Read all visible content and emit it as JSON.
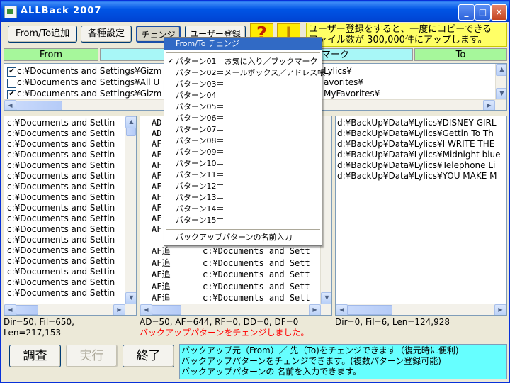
{
  "window": {
    "title": "ALLBack 2007",
    "minimize_glyph": "_",
    "maximize_glyph": "□",
    "close_glyph": "×"
  },
  "toolbar": {
    "fromto_add": "From/To追加",
    "settings": "各種設定",
    "change": "チェンジ",
    "user_register": "ユーザー登録",
    "help_glyph": "?",
    "register_glyph": "I"
  },
  "banner": {
    "line1": "ユーザー登録をすると、一度にコピーできる",
    "line2": "ファイル数が 300,000件にアップします。"
  },
  "headers": {
    "from": "From",
    "middle": "マーク",
    "to": "To"
  },
  "from_to_list": [
    {
      "checked": true,
      "from": "c:¥Documents and Settings¥Gizm",
      "to": "Lylics¥"
    },
    {
      "checked": false,
      "from": "c:¥Documents and Settings¥All U",
      "to": "avorites¥"
    },
    {
      "checked": true,
      "from": "c:¥Documents and Settings¥Gizm",
      "to": "MyFavorites¥"
    }
  ],
  "left_panel": {
    "lines": [
      "c:¥Documents and Settin",
      "c:¥Documents and Settin",
      "c:¥Documents and Settin",
      "c:¥Documents and Settin",
      "c:¥Documents and Settin",
      "c:¥Documents and Settin",
      "c:¥Documents and Settin",
      "c:¥Documents and Settin",
      "c:¥Documents and Settin",
      "c:¥Documents and Settin",
      "c:¥Documents and Settin",
      "c:¥Documents and Settin",
      "c:¥Documents and Settin",
      "c:¥Documents and Settin",
      "c:¥Documents and Settin",
      "c:¥Documents and Settin",
      "c:¥Documents and Settin"
    ],
    "status1": "Dir=50, Fil=650,",
    "status2": "Len=217,153"
  },
  "mid_panel": {
    "short_lines": [
      "AD",
      "AD",
      "AF",
      "AF",
      "AF",
      "AF",
      "AF",
      "AF",
      "AF",
      "AF",
      "AF"
    ],
    "long_lines": [
      {
        "kind": "AF追",
        "path": "c:¥Documents and Sett"
      },
      {
        "kind": "AF追",
        "path": "c:¥Documents and Sett"
      },
      {
        "kind": "AF追",
        "path": "c:¥Documents and Sett"
      },
      {
        "kind": "AF追",
        "path": "c:¥Documents and Sett"
      },
      {
        "kind": "AF追",
        "path": "c:¥Documents and Sett"
      },
      {
        "kind": "AF追",
        "path": "c:¥Documents and Sett"
      }
    ],
    "status1": "AD=50, AF=644, RF=0, DD=0, DF=0",
    "status2": "バックアップパターンをチェンジしました。"
  },
  "right_panel": {
    "lines": [
      "d:¥BackUp¥Data¥Lylics¥DISNEY GIRL",
      "d:¥BackUp¥Data¥Lylics¥Gettin To Th",
      "d:¥BackUp¥Data¥Lylics¥I WRITE THE",
      "d:¥BackUp¥Data¥Lylics¥Midnight blue",
      "d:¥BackUp¥Data¥Lylics¥Telephone Li",
      "d:¥BackUp¥Data¥Lylics¥YOU MAKE M"
    ],
    "status1": "Dir=0, Fil=6, Len=124,928"
  },
  "bottom_buttons": {
    "survey": "調査",
    "run": "実行",
    "quit": "終了"
  },
  "info": {
    "line1": "バックアップ元（From）／ 先（To)をチェンジできます（復元時に便利)",
    "line2": "バックアップパターンをチェンジできます。(複数パターン登録可能)",
    "line3": "バックアップパターンの 名前を入力できます。"
  },
  "menu": {
    "header": "From/To チェンジ",
    "patterns": [
      "パターン01＝お気に入り／ブックマーク",
      "パターン02＝メールボックス／アドレス帳",
      "パターン03＝",
      "パターン04＝",
      "パターン05＝",
      "パターン06＝",
      "パターン07＝",
      "パターン08＝",
      "パターン09＝",
      "パターン10＝",
      "パターン11＝",
      "パターン12＝",
      "パターン13＝",
      "パターン14＝",
      "パターン15＝"
    ],
    "checked_index": 0,
    "check_glyph": "✔",
    "name_input": "バックアップパターンの名前入力"
  },
  "colors": {
    "header_green": "#a6f79b",
    "header_cyan": "#a8f7f7",
    "banner_yellow": "#ffff66",
    "info_cyan": "#66ffff",
    "status_red": "#ff0000",
    "highlight_blue": "#316ac5"
  }
}
